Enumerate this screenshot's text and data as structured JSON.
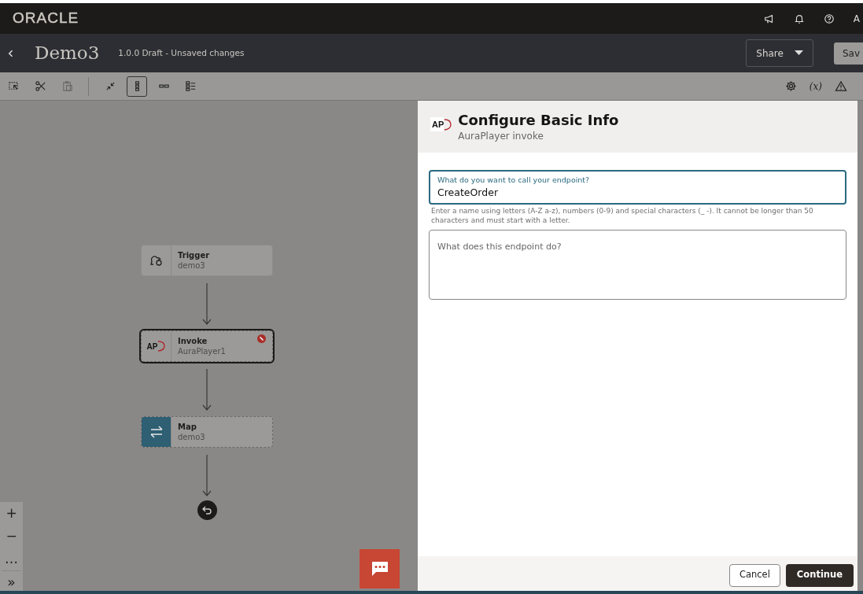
{
  "header": {
    "brand": "ORACLE",
    "avatar_letter": "A"
  },
  "titlebar": {
    "title": "Demo3",
    "status": "1.0.0 Draft - Unsaved changes",
    "share": "Share",
    "save": "Sav"
  },
  "toolbar": {
    "tools": [
      {
        "kind": "select",
        "disabled": false
      },
      {
        "kind": "cut",
        "disabled": false
      },
      {
        "kind": "paste",
        "disabled": true
      },
      {
        "kind": "collapse",
        "disabled": false
      }
    ],
    "layouts": [
      {
        "kind": "vertical",
        "selected": true
      },
      {
        "kind": "horizontal",
        "selected": false
      },
      {
        "kind": "list",
        "selected": false
      }
    ],
    "variables": "(x)"
  },
  "flow": {
    "nodes": [
      {
        "kind": "trigger",
        "title": "Trigger",
        "subtitle": "demo3",
        "selected": false,
        "error": false,
        "configured": true
      },
      {
        "kind": "invoke",
        "badge": "AP",
        "title": "Invoke",
        "subtitle": "AuraPlayer1",
        "selected": true,
        "error": true,
        "configured": false
      },
      {
        "kind": "map",
        "title": "Map",
        "subtitle": "demo3",
        "selected": false,
        "error": false,
        "configured": false
      }
    ]
  },
  "zoom_controls": [
    "+",
    "−",
    "…",
    "»"
  ],
  "panel": {
    "badge": "AP",
    "title": "Configure Basic Info",
    "subtitle": "AuraPlayer invoke",
    "name_field": {
      "label": "What do you want to call your endpoint?",
      "value": "CreateOrder",
      "help": "Enter a name using letters (A-Z a-z), numbers (0-9) and special characters (_ -). It cannot be longer than 50 characters and must start with a letter."
    },
    "description_field": {
      "placeholder": "What does this endpoint do?"
    },
    "buttons": [
      "Cancel",
      "Continue"
    ]
  }
}
